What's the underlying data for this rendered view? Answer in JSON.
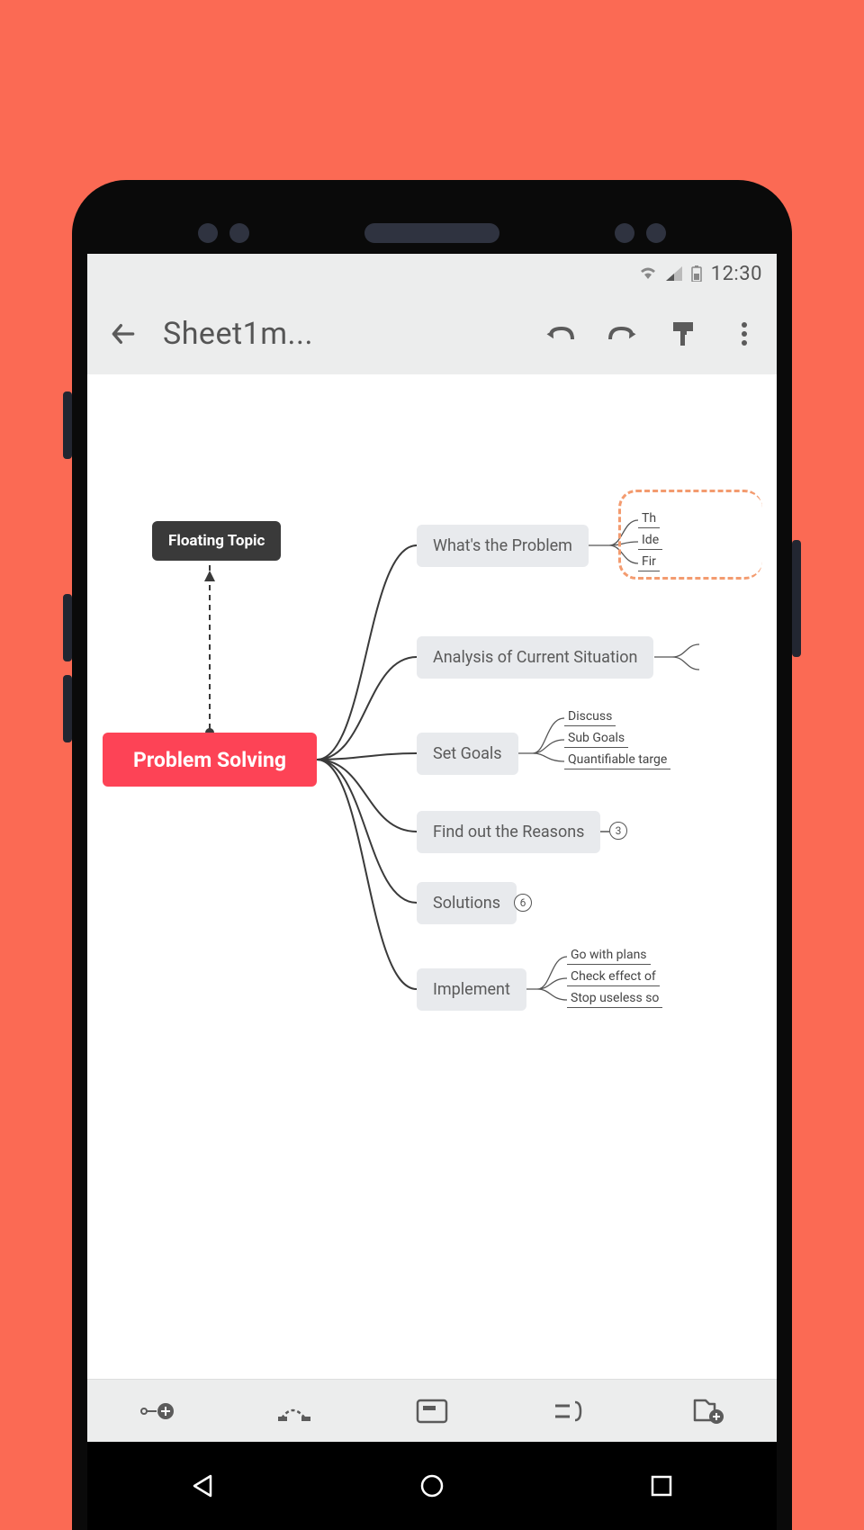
{
  "status_bar": {
    "time": "12:30"
  },
  "app_bar": {
    "title": "Sheet1m..."
  },
  "mindmap": {
    "central": "Problem Solving",
    "floating": "Floating Topic",
    "branches": [
      {
        "label": "What's the Problem",
        "subs": [
          "Th",
          "Ide",
          "Fir"
        ]
      },
      {
        "label": "Analysis of Current Situation",
        "subs": []
      },
      {
        "label": "Set Goals",
        "subs": [
          "Discuss",
          "Sub Goals",
          "Quantifiable targe"
        ]
      },
      {
        "label": "Find out the Reasons",
        "badge": "3"
      },
      {
        "label": "Solutions",
        "badge": "6"
      },
      {
        "label": "Implement",
        "subs": [
          "Go with plans",
          "Check effect of",
          "Stop useless so"
        ]
      }
    ]
  }
}
